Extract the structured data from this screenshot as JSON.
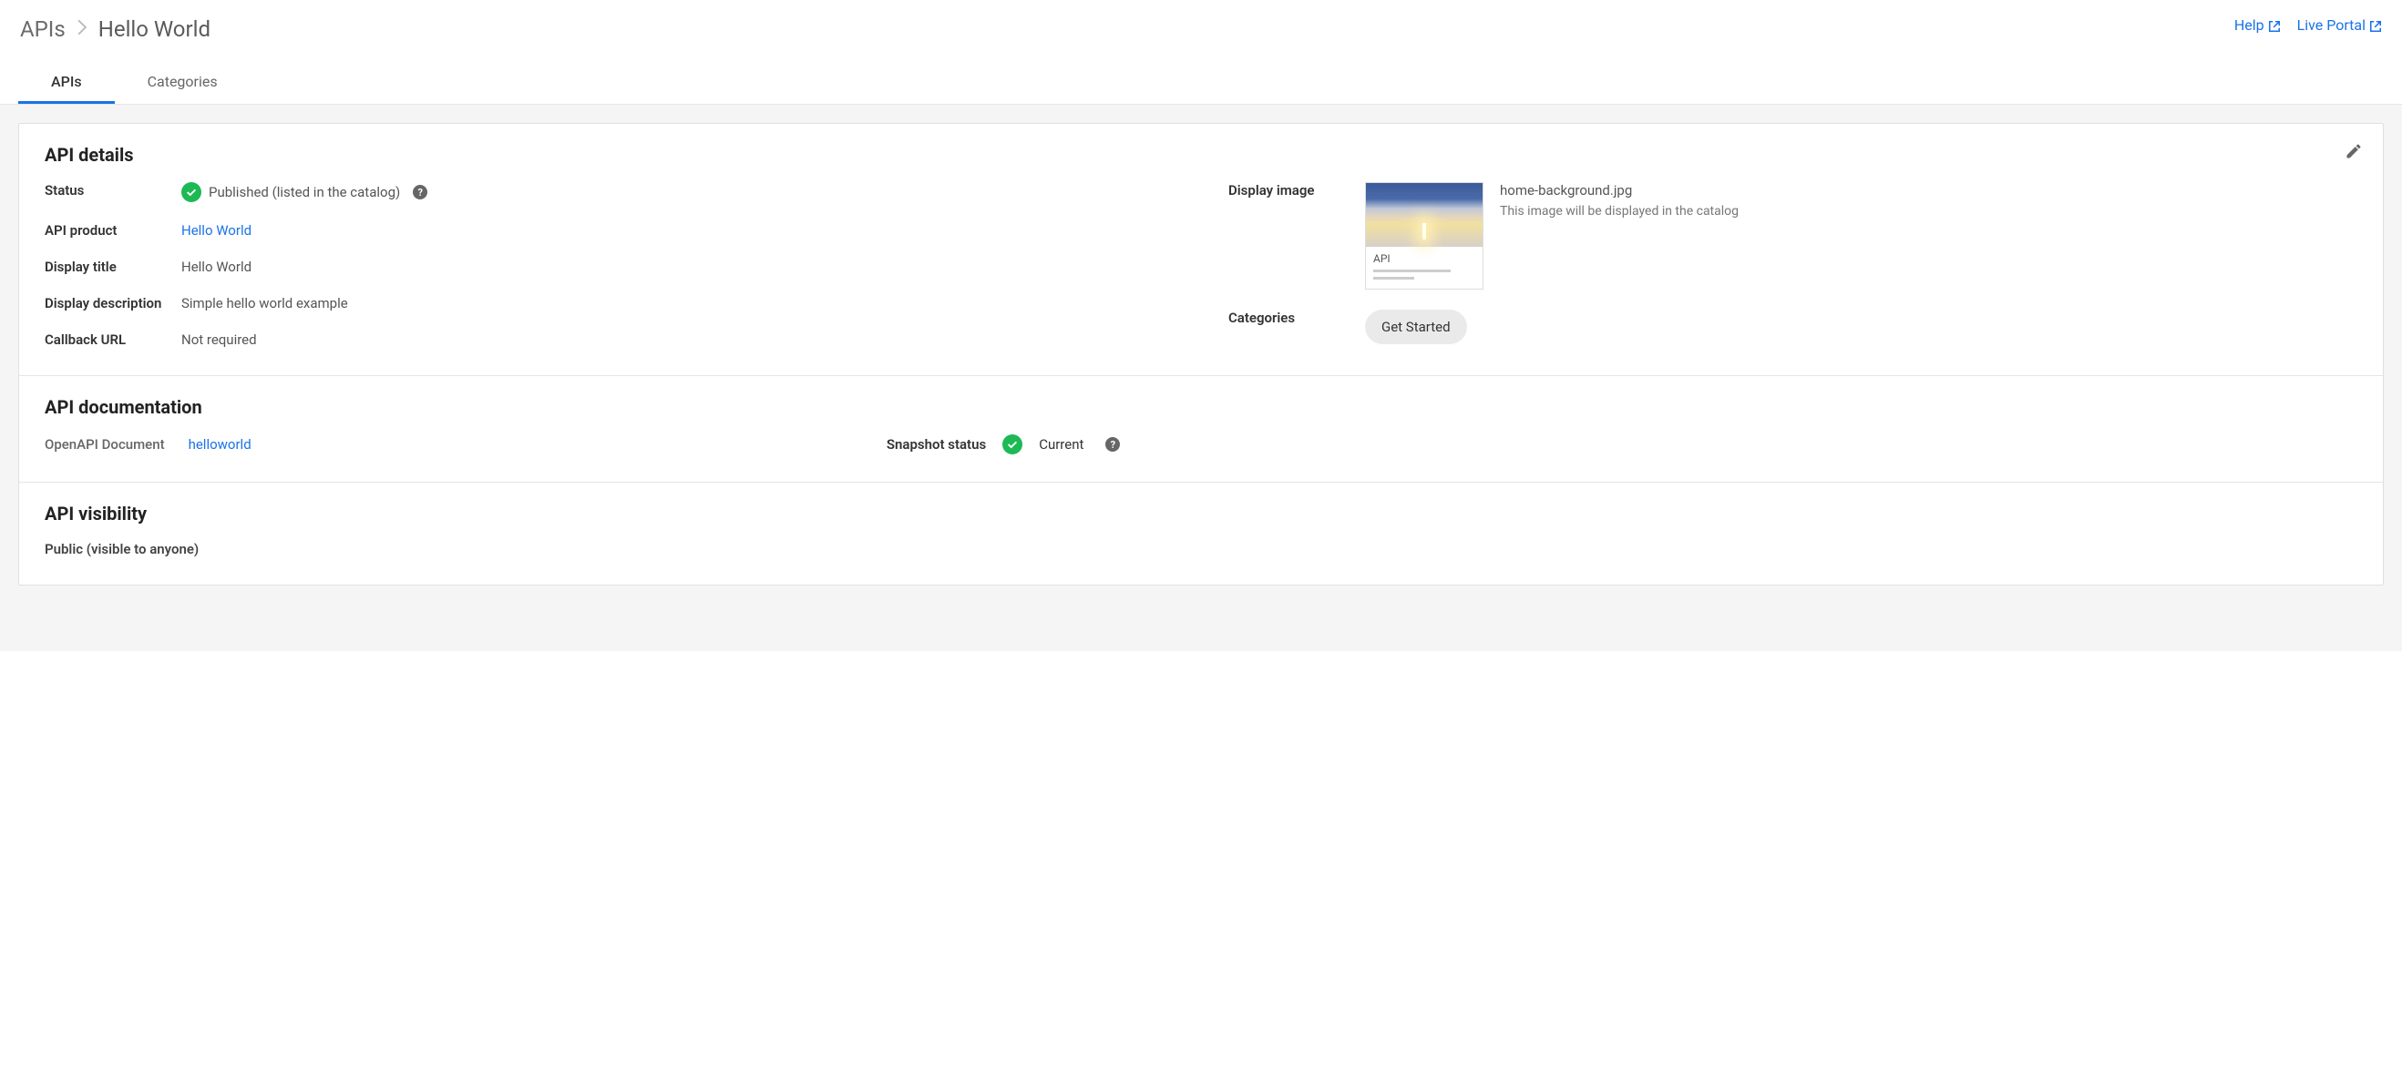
{
  "breadcrumb": {
    "root": "APIs",
    "current": "Hello World"
  },
  "header_links": {
    "help": "Help",
    "live_portal": "Live Portal"
  },
  "tabs": {
    "apis": "APIs",
    "categories": "Categories"
  },
  "details": {
    "title": "API details",
    "status_label": "Status",
    "status_value": "Published (listed in the catalog)",
    "product_label": "API product",
    "product_value": "Hello World",
    "display_title_label": "Display title",
    "display_title_value": "Hello World",
    "display_description_label": "Display description",
    "display_description_value": "Simple hello world example",
    "callback_label": "Callback URL",
    "callback_value": "Not required",
    "display_image_label": "Display image",
    "display_image_caption": "API",
    "display_image_filename": "home-background.jpg",
    "display_image_desc": "This image will be displayed in the catalog",
    "categories_label": "Categories",
    "categories_chip": "Get Started"
  },
  "documentation": {
    "title": "API documentation",
    "doc_label": "OpenAPI Document",
    "doc_link": "helloworld",
    "snapshot_label": "Snapshot status",
    "snapshot_value": "Current"
  },
  "visibility": {
    "title": "API visibility",
    "value": "Public (visible to anyone)"
  }
}
